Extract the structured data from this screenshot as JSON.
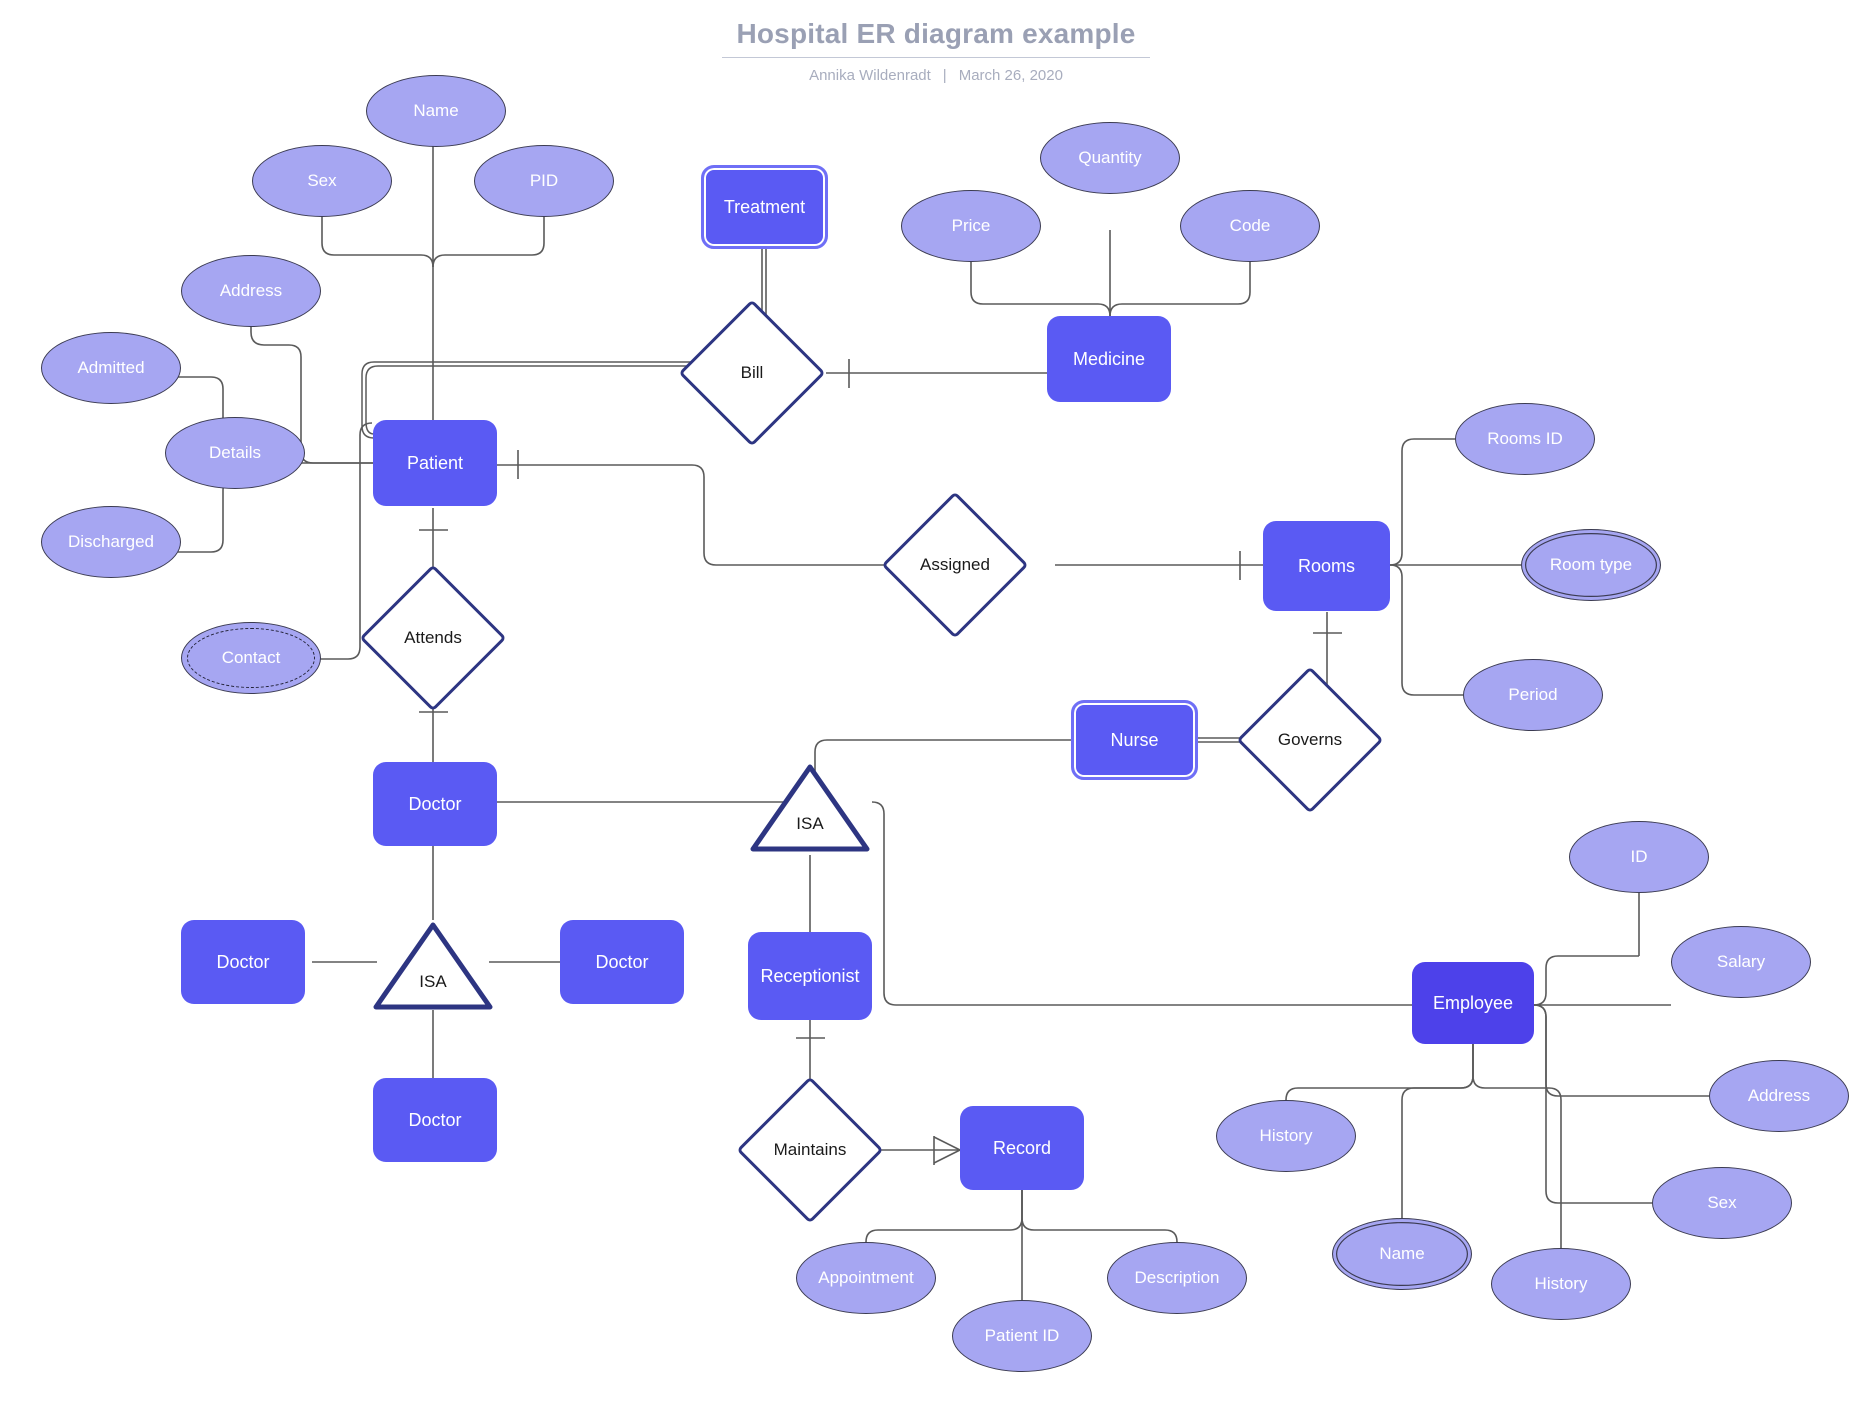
{
  "document": {
    "title": "Hospital ER diagram example",
    "author": "Annika Wildenradt",
    "separator": "|",
    "date": "March 26, 2020"
  },
  "palette": {
    "entity_fill": "#5a5af3",
    "entity_fill_strong": "#4d41ea",
    "attribute_fill": "#a6a6f2",
    "relationship_border": "#2d3582",
    "relationship_fill": "#ffffff",
    "line": "#5a5a5a",
    "title_text": "#9aa0b4",
    "subtitle_text": "#a8adbe",
    "label_text": "#ffffff"
  },
  "entities": [
    {
      "id": "patient",
      "label": "Patient",
      "kind": "entity"
    },
    {
      "id": "treatment",
      "label": "Treatment",
      "kind": "weak-entity"
    },
    {
      "id": "medicine",
      "label": "Medicine",
      "kind": "entity"
    },
    {
      "id": "rooms",
      "label": "Rooms",
      "kind": "entity"
    },
    {
      "id": "nurse",
      "label": "Nurse",
      "kind": "weak-entity"
    },
    {
      "id": "doctor",
      "label": "Doctor",
      "kind": "entity"
    },
    {
      "id": "doctor-left",
      "label": "Doctor",
      "kind": "entity"
    },
    {
      "id": "doctor-right",
      "label": "Doctor",
      "kind": "entity"
    },
    {
      "id": "doctor-bottom",
      "label": "Doctor",
      "kind": "entity"
    },
    {
      "id": "receptionist",
      "label": "Receptionist",
      "kind": "entity"
    },
    {
      "id": "record",
      "label": "Record",
      "kind": "entity"
    },
    {
      "id": "employee",
      "label": "Employee",
      "kind": "entity"
    }
  ],
  "relationships": [
    {
      "id": "bill",
      "label": "Bill"
    },
    {
      "id": "assigned",
      "label": "Assigned"
    },
    {
      "id": "attends",
      "label": "Attends"
    },
    {
      "id": "governs",
      "label": "Governs"
    },
    {
      "id": "maintains",
      "label": "Maintains"
    }
  ],
  "generalizations": [
    {
      "id": "isa-doctor",
      "label": "ISA"
    },
    {
      "id": "isa-receptionist",
      "label": "ISA"
    }
  ],
  "attributes": {
    "patient": [
      {
        "id": "name",
        "label": "Name",
        "kind": "simple"
      },
      {
        "id": "sex",
        "label": "Sex",
        "kind": "simple"
      },
      {
        "id": "pid",
        "label": "PID",
        "kind": "simple"
      },
      {
        "id": "address",
        "label": "Address",
        "kind": "simple"
      },
      {
        "id": "admitted",
        "label": "Admitted",
        "kind": "simple"
      },
      {
        "id": "details",
        "label": "Details",
        "kind": "simple"
      },
      {
        "id": "discharged",
        "label": "Discharged",
        "kind": "simple"
      },
      {
        "id": "contact",
        "label": "Contact",
        "kind": "derived"
      }
    ],
    "medicine": [
      {
        "id": "price",
        "label": "Price",
        "kind": "simple"
      },
      {
        "id": "quantity",
        "label": "Quantity",
        "kind": "simple"
      },
      {
        "id": "code",
        "label": "Code",
        "kind": "simple"
      }
    ],
    "rooms": [
      {
        "id": "rooms-id",
        "label": "Rooms ID",
        "kind": "simple"
      },
      {
        "id": "room-type",
        "label": "Room type",
        "kind": "multivalued"
      },
      {
        "id": "period",
        "label": "Period",
        "kind": "simple"
      }
    ],
    "record": [
      {
        "id": "appointment",
        "label": "Appointment",
        "kind": "simple"
      },
      {
        "id": "patient-id",
        "label": "Patient ID",
        "kind": "simple"
      },
      {
        "id": "description",
        "label": "Description",
        "kind": "simple"
      }
    ],
    "employee": [
      {
        "id": "emp-id",
        "label": "ID",
        "kind": "simple"
      },
      {
        "id": "emp-salary",
        "label": "Salary",
        "kind": "simple"
      },
      {
        "id": "emp-address",
        "label": "Address",
        "kind": "simple"
      },
      {
        "id": "emp-sex",
        "label": "Sex",
        "kind": "simple"
      },
      {
        "id": "emp-history1",
        "label": "History",
        "kind": "simple"
      },
      {
        "id": "emp-name",
        "label": "Name",
        "kind": "multivalued"
      },
      {
        "id": "emp-history2",
        "label": "History",
        "kind": "simple"
      }
    ]
  }
}
